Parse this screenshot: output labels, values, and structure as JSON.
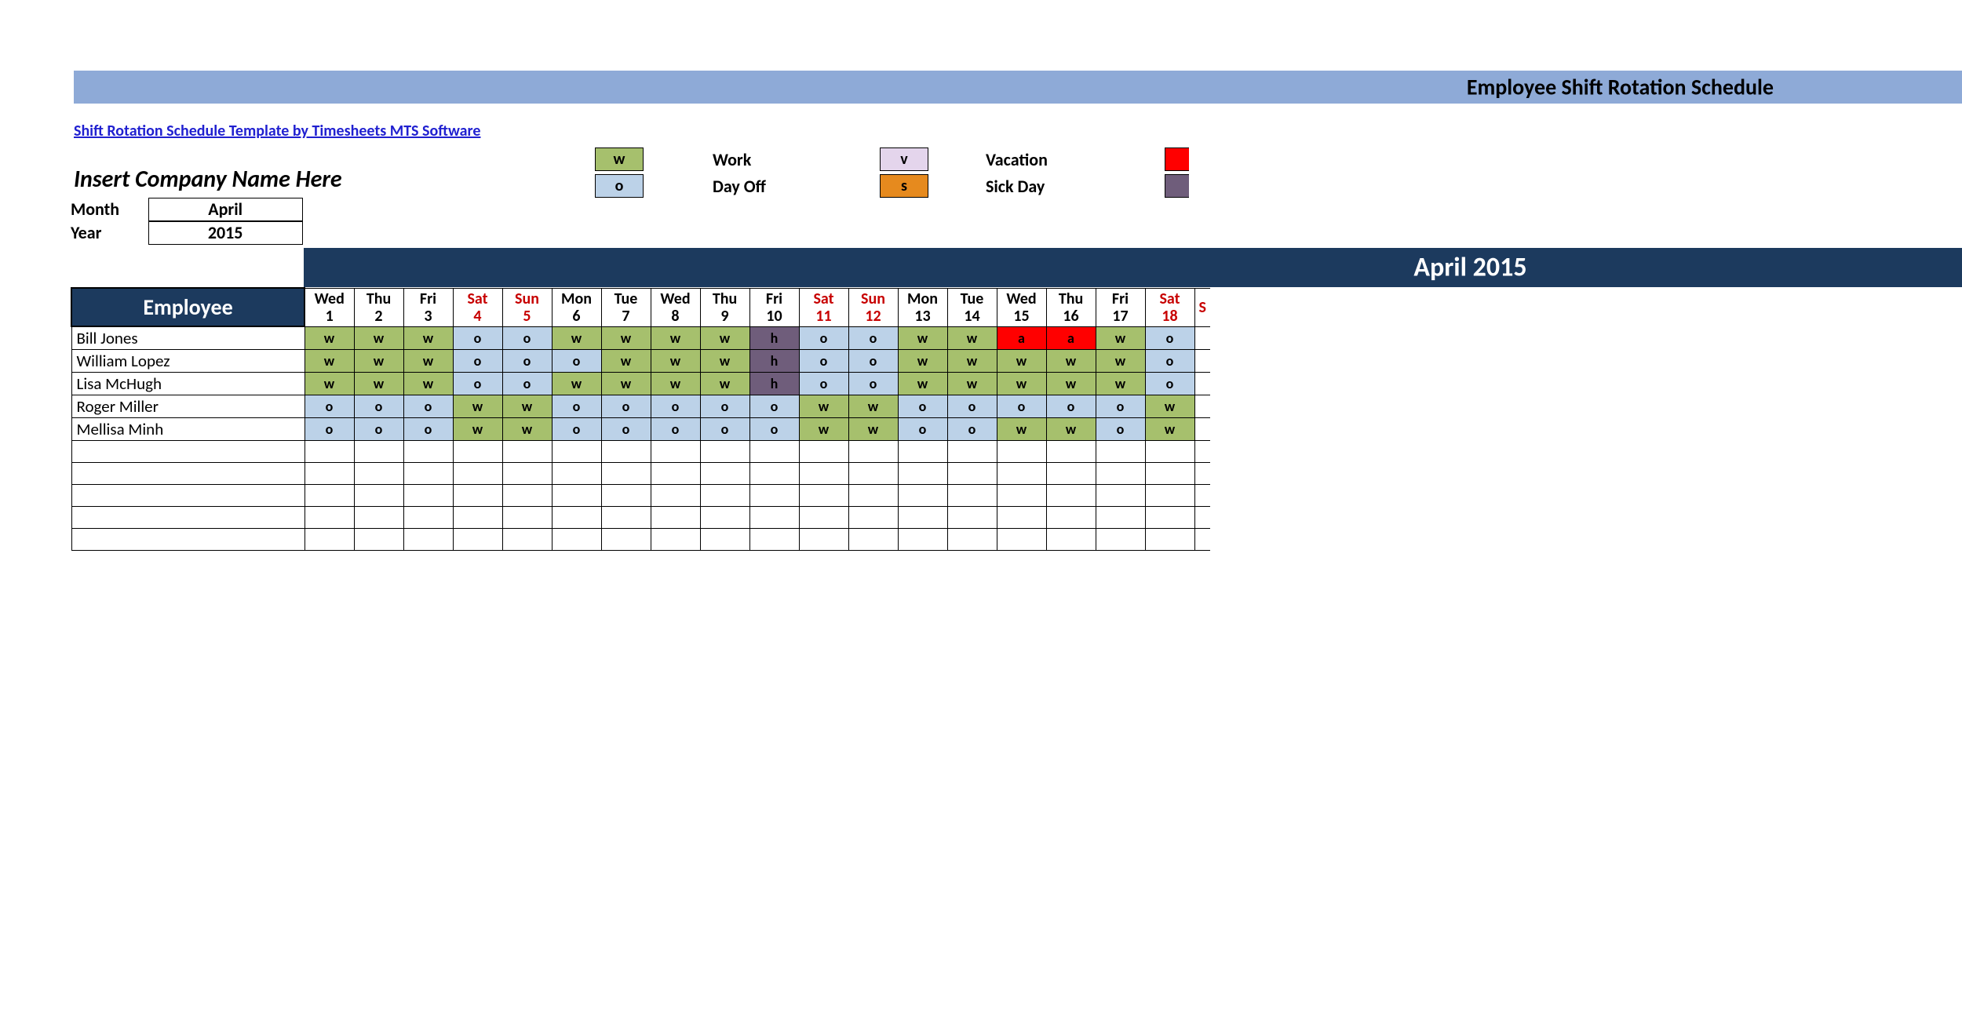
{
  "header": {
    "title": "Employee Shift Rotation Schedule",
    "source_link": "Shift Rotation Schedule Template by Timesheets MTS Software",
    "company": "Insert Company Name Here",
    "month_label": "Month",
    "month_value": "April",
    "year_label": "Year",
    "year_value": "2015"
  },
  "legend": [
    {
      "code": "w",
      "label": "Work",
      "class": "c-w"
    },
    {
      "code": "o",
      "label": "Day Off",
      "class": "c-o"
    },
    {
      "code": "v",
      "label": "Vacation",
      "class": "c-v"
    },
    {
      "code": "s",
      "label": "Sick Day",
      "class": "c-s"
    }
  ],
  "extra_swatches": [
    {
      "class": "c-red"
    },
    {
      "class": "c-purple"
    }
  ],
  "schedule": {
    "month_title": "April 2015",
    "employee_header": "Employee",
    "days": [
      {
        "dow": "Wed",
        "dom": "1",
        "weekend": false
      },
      {
        "dow": "Thu",
        "dom": "2",
        "weekend": false
      },
      {
        "dow": "Fri",
        "dom": "3",
        "weekend": false
      },
      {
        "dow": "Sat",
        "dom": "4",
        "weekend": true
      },
      {
        "dow": "Sun",
        "dom": "5",
        "weekend": true
      },
      {
        "dow": "Mon",
        "dom": "6",
        "weekend": false
      },
      {
        "dow": "Tue",
        "dom": "7",
        "weekend": false
      },
      {
        "dow": "Wed",
        "dom": "8",
        "weekend": false
      },
      {
        "dow": "Thu",
        "dom": "9",
        "weekend": false
      },
      {
        "dow": "Fri",
        "dom": "10",
        "weekend": false
      },
      {
        "dow": "Sat",
        "dom": "11",
        "weekend": true
      },
      {
        "dow": "Sun",
        "dom": "12",
        "weekend": true
      },
      {
        "dow": "Mon",
        "dom": "13",
        "weekend": false
      },
      {
        "dow": "Tue",
        "dom": "14",
        "weekend": false
      },
      {
        "dow": "Wed",
        "dom": "15",
        "weekend": false
      },
      {
        "dow": "Thu",
        "dom": "16",
        "weekend": false
      },
      {
        "dow": "Fri",
        "dom": "17",
        "weekend": false
      },
      {
        "dow": "Sat",
        "dom": "18",
        "weekend": true
      },
      {
        "dow": "S",
        "dom": "",
        "weekend": true
      }
    ],
    "employees": [
      {
        "name": "Bill Jones",
        "shifts": [
          "w",
          "w",
          "w",
          "o",
          "o",
          "w",
          "w",
          "w",
          "w",
          "h",
          "o",
          "o",
          "w",
          "w",
          "a",
          "a",
          "w",
          "o",
          ""
        ]
      },
      {
        "name": "William Lopez",
        "shifts": [
          "w",
          "w",
          "w",
          "o",
          "o",
          "o",
          "w",
          "w",
          "w",
          "h",
          "o",
          "o",
          "w",
          "w",
          "w",
          "w",
          "w",
          "o",
          ""
        ]
      },
      {
        "name": "Lisa McHugh",
        "shifts": [
          "w",
          "w",
          "w",
          "o",
          "o",
          "w",
          "w",
          "w",
          "w",
          "h",
          "o",
          "o",
          "w",
          "w",
          "w",
          "w",
          "w",
          "o",
          ""
        ]
      },
      {
        "name": "Roger Miller",
        "shifts": [
          "o",
          "o",
          "o",
          "w",
          "w",
          "o",
          "o",
          "o",
          "o",
          "o",
          "w",
          "w",
          "o",
          "o",
          "o",
          "o",
          "o",
          "w",
          ""
        ]
      },
      {
        "name": "Mellisa Minh",
        "shifts": [
          "o",
          "o",
          "o",
          "w",
          "w",
          "o",
          "o",
          "o",
          "o",
          "o",
          "w",
          "w",
          "o",
          "o",
          "w",
          "w",
          "o",
          "w",
          ""
        ]
      }
    ],
    "empty_rows": 5
  },
  "colors": {
    "w": "c-w",
    "o": "c-o",
    "v": "c-v",
    "s": "c-s",
    "h": "c-h",
    "a": "c-a"
  },
  "layout": {
    "emp_col_width": 297,
    "day_col_width": 63
  }
}
